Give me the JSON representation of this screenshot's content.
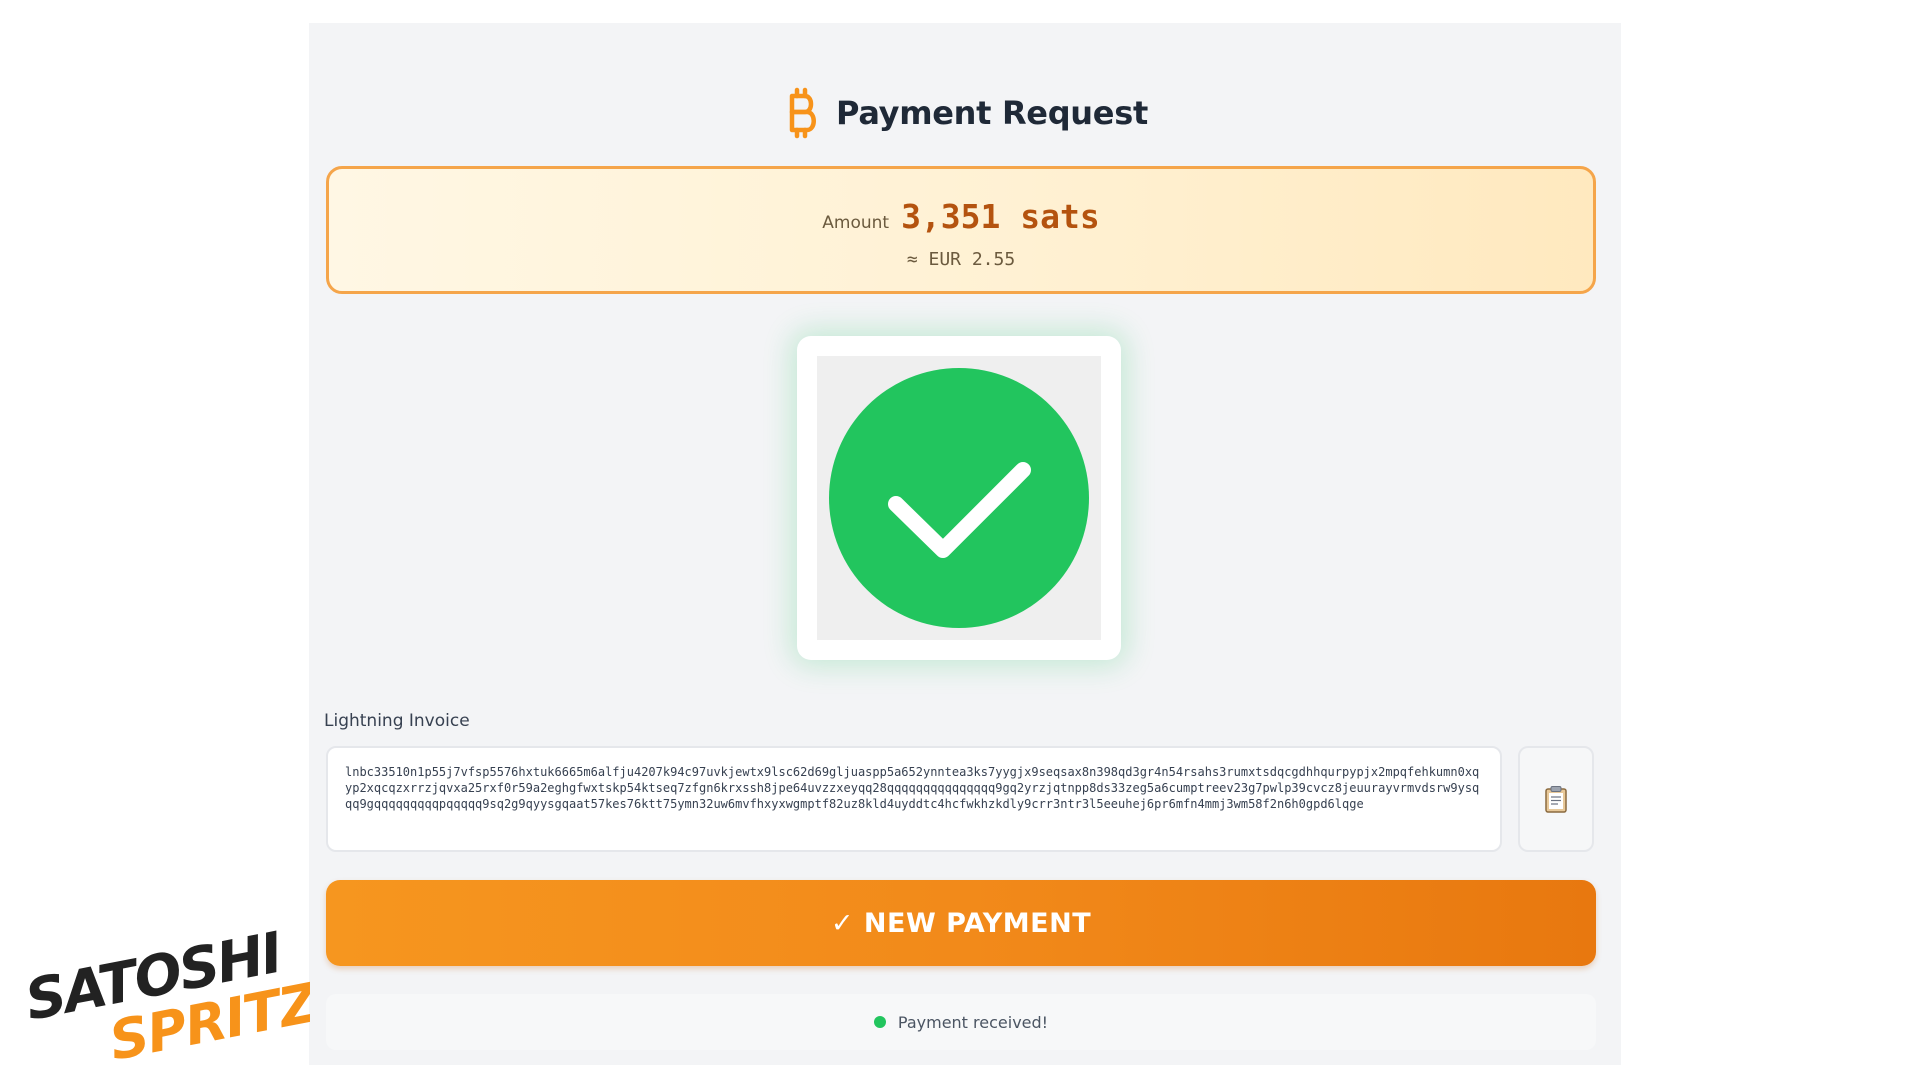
{
  "header": {
    "title": "Payment Request",
    "icon": "bitcoin-icon"
  },
  "amount": {
    "label": "Amount",
    "value": "3,351 sats",
    "fiat": "≈ EUR 2.55"
  },
  "status_graphic": {
    "icon": "check-circle-icon",
    "color": "#22c55e"
  },
  "invoice": {
    "label": "Lightning Invoice",
    "value": "lnbc33510n1p55j7vfsp5576hxtuk6665m6alfju4207k94c97uvkjewtx9lsc62d69gljuaspp5a652ynntea3ks7yygjx9seqsax8n398qd3gr4n54rsahs3rumxtsdqcgdhhqurpypjx2mpqfehkumn0xqyp2xqcqzxrrzjqvxa25rxf0r59a2eghgfwxtskp54ktseq7zfgn6krxssh8jpe64uvzzxeyqq28qqqqqqqqqqqqqqq9gq2yrzjqtnpp8ds33zeg5a6cumptreev23g7pwlp39cvcz8jeuurayvrmvdsrw9ysqqq9gqqqqqqqqqpqqqqq9sq2g9qyysgqaat57kes76ktt75ymn32uw6mvfhxyxwgmptf82uz8kld4uyddtc4hcfwkhzkdly9crr3ntr3l5eeuhej6pr6mfn4mmj3wm58f2n6h0gpd6lqge",
    "copy_icon": "clipboard-icon"
  },
  "actions": {
    "new_payment": "✓ NEW PAYMENT"
  },
  "status": {
    "text": "Payment received!",
    "color": "#22c55e"
  },
  "logo": {
    "line1": "SATOSHI",
    "line2": "SPRITZ"
  },
  "colors": {
    "accent": "#f7931a",
    "success": "#22c55e",
    "amount_text": "#b4530f"
  }
}
